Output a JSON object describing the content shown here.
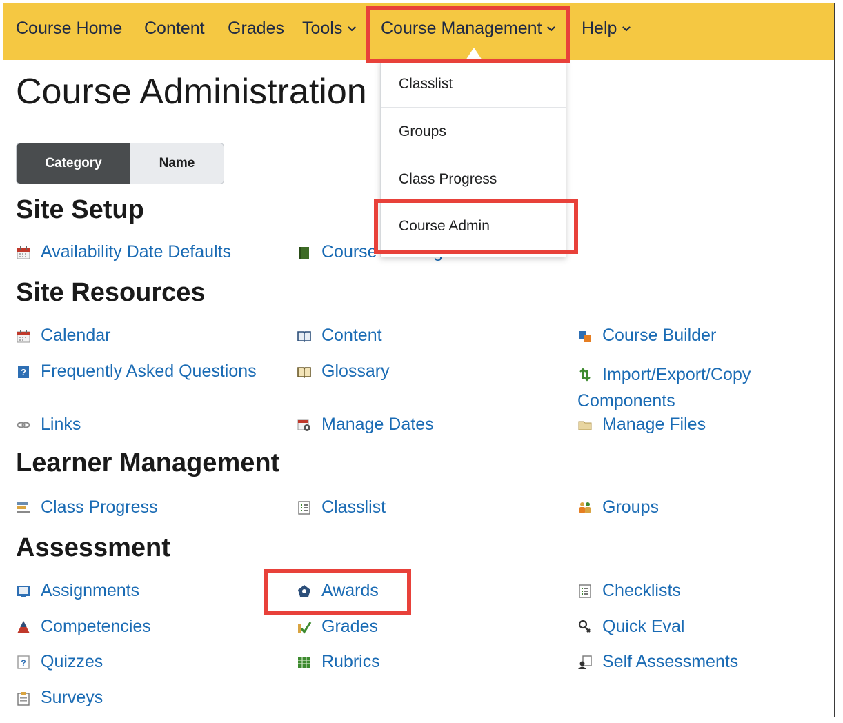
{
  "nav": {
    "items": [
      {
        "label": "Course Home"
      },
      {
        "label": "Content"
      },
      {
        "label": "Grades"
      },
      {
        "label": "Tools"
      },
      {
        "label": "Course Management"
      },
      {
        "label": "Help"
      }
    ]
  },
  "page": {
    "title": "Course Administration"
  },
  "view_toggle": {
    "category_label": "Category",
    "name_label": "Name"
  },
  "dropdown": {
    "items": [
      {
        "label": "Classlist"
      },
      {
        "label": "Groups"
      },
      {
        "label": "Class Progress"
      },
      {
        "label": "Course Admin"
      }
    ]
  },
  "sections": {
    "site_setup": {
      "title": "Site Setup",
      "links": [
        {
          "label": "Availability Date Defaults",
          "icon": "calendar-icon"
        },
        {
          "label": "Course Offering Information",
          "icon": "book-icon"
        }
      ]
    },
    "site_resources": {
      "title": "Site Resources",
      "links": [
        {
          "label": "Calendar",
          "icon": "calendar-icon"
        },
        {
          "label": "Content",
          "icon": "open-book-icon"
        },
        {
          "label": "Course Builder",
          "icon": "course-builder-icon"
        },
        {
          "label": "Frequently Asked Questions",
          "icon": "faq-icon"
        },
        {
          "label": "Glossary",
          "icon": "glossary-icon"
        },
        {
          "label": "Import/Export/Copy Components",
          "icon": "import-export-icon"
        },
        {
          "label": "Links",
          "icon": "link-icon"
        },
        {
          "label": "Manage Dates",
          "icon": "manage-dates-icon"
        },
        {
          "label": "Manage Files",
          "icon": "folder-icon"
        }
      ]
    },
    "learner_management": {
      "title": "Learner Management",
      "links": [
        {
          "label": "Class Progress",
          "icon": "progress-icon"
        },
        {
          "label": "Classlist",
          "icon": "list-icon"
        },
        {
          "label": "Groups",
          "icon": "groups-icon"
        }
      ]
    },
    "assessment": {
      "title": "Assessment",
      "links": [
        {
          "label": "Assignments",
          "icon": "assignment-icon"
        },
        {
          "label": "Awards",
          "icon": "award-icon"
        },
        {
          "label": "Checklists",
          "icon": "checklist-icon"
        },
        {
          "label": "Competencies",
          "icon": "competencies-icon"
        },
        {
          "label": "Grades",
          "icon": "grades-icon"
        },
        {
          "label": "Quick Eval",
          "icon": "quick-eval-icon"
        },
        {
          "label": "Quizzes",
          "icon": "quiz-icon"
        },
        {
          "label": "Rubrics",
          "icon": "rubric-icon"
        },
        {
          "label": "Self Assessments",
          "icon": "self-assessment-icon"
        },
        {
          "label": "Surveys",
          "icon": "survey-icon"
        }
      ]
    }
  },
  "colors": {
    "nav_bg": "#f5c842",
    "link": "#1a6bb4",
    "highlight": "#e8413a",
    "toggle_active": "#494c4e"
  }
}
